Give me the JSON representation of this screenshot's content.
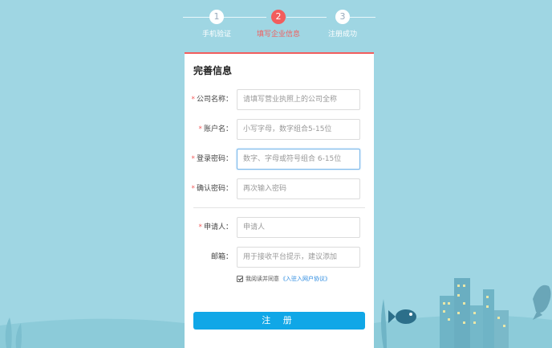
{
  "steps": [
    {
      "number": "1",
      "label": "手机验证"
    },
    {
      "number": "2",
      "label": "填写企业信息"
    },
    {
      "number": "3",
      "label": "注册成功"
    }
  ],
  "active_step": 2,
  "form": {
    "title": "完善信息",
    "required_mark": "*",
    "company_name": {
      "label": "公司名称：",
      "placeholder": "请填写营业执照上的公司全称"
    },
    "account": {
      "label": "账户名：",
      "placeholder": "小写字母，数字组合5-15位"
    },
    "password": {
      "label": "登录密码：",
      "placeholder": "数字、字母或符号组合 6-15位"
    },
    "confirm_password": {
      "label": "确认密码：",
      "placeholder": "再次输入密码"
    },
    "applicant": {
      "label": "申请人：",
      "placeholder": "申请人"
    },
    "email": {
      "label": "邮箱：",
      "placeholder": "用于接收平台提示，建议添加"
    },
    "agreement_text": "我阅读并同意",
    "agreement_link": "《入驻入网户协议》",
    "submit_label": "注 册"
  },
  "colors": {
    "accent_red": "#f25d5d",
    "button_blue": "#10a7e7",
    "background": "#9fd6e3"
  }
}
